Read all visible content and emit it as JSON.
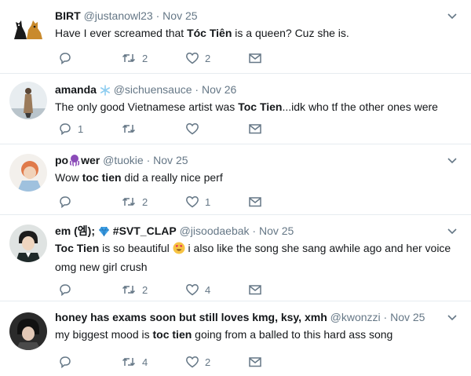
{
  "tweets": [
    {
      "name": "BIRT",
      "handle": "@justanowl23",
      "dot": "·",
      "time": "Nov 25",
      "text_before": "Have I ever screamed that ",
      "text_bold": "Tóc Tiên",
      "text_after": " is a queen? Cuz she is.",
      "reply_count": "",
      "retweet_count": "2",
      "like_count": "2"
    },
    {
      "name": "amanda",
      "handle": "@sichuensauce",
      "dot": "·",
      "time": "Nov 26",
      "text_before": "The only good Vietnamese artist was ",
      "text_bold": "Toc Tien",
      "text_after": "...idk who tf the other ones were",
      "reply_count": "1",
      "retweet_count": "",
      "like_count": ""
    },
    {
      "name_a": "po",
      "name_b": "wer",
      "handle": "@tuokie",
      "dot": "·",
      "time": "Nov 25",
      "text_before": "Wow ",
      "text_bold": "toc tien",
      "text_after": " did a really nice perf",
      "reply_count": "",
      "retweet_count": "2",
      "like_count": "1"
    },
    {
      "name_a": "em (엠);",
      "name_b": "#SVT_CLAP",
      "handle": "@jisoodaebak",
      "dot": "·",
      "time": "Nov 25",
      "text_bold": "Toc Tien",
      "text_mid": " is so beautiful ",
      "text_after": " i also like the song she sang awhile ago and her voice",
      "text_line2": "omg new girl crush",
      "reply_count": "",
      "retweet_count": "2",
      "like_count": "4"
    },
    {
      "name": "honey has exams soon but still loves kmg, ksy, xmh",
      "handle": "@kwonzzi",
      "dot": "·",
      "time": "Nov 25",
      "text_before": "my biggest mood is ",
      "text_bold": "toc tien",
      "text_after": " going from a balled to this hard ass song",
      "reply_count": "",
      "retweet_count": "4",
      "like_count": "2"
    }
  ],
  "icons": {
    "reply": "reply-icon",
    "retweet": "retweet-icon",
    "like": "heart-icon",
    "dm": "envelope-icon",
    "caret": "chevron-down-icon"
  },
  "colors": {
    "muted": "#657786",
    "text": "#14171a",
    "divider": "#e6ecf0",
    "snowflake": "#8ecdf0",
    "octopus": "#8b4bb8",
    "gem": "#3ea0e6"
  }
}
